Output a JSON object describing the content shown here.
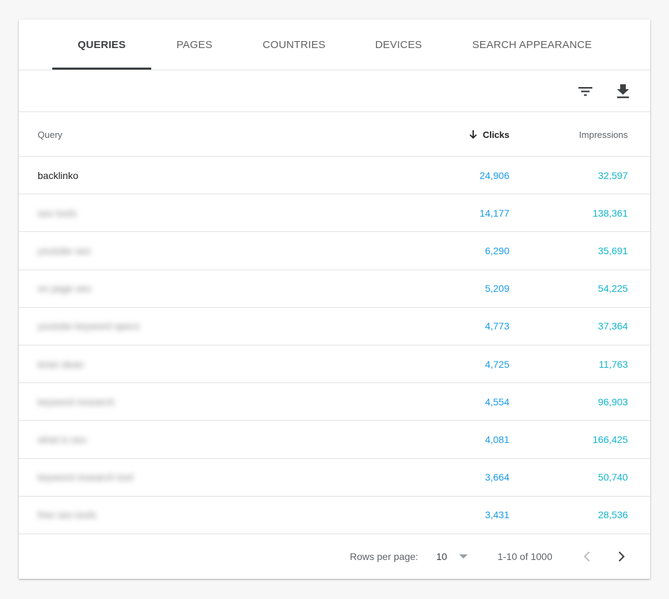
{
  "tabs": [
    {
      "label": "QUERIES",
      "active": true
    },
    {
      "label": "PAGES",
      "active": false
    },
    {
      "label": "COUNTRIES",
      "active": false
    },
    {
      "label": "DEVICES",
      "active": false
    },
    {
      "label": "SEARCH APPEARANCE",
      "active": false
    }
  ],
  "toolbar": {
    "filter_icon": "filter-icon",
    "download_icon": "download-icon"
  },
  "table": {
    "columns": {
      "query": "Query",
      "clicks": "Clicks",
      "impressions": "Impressions"
    },
    "sort_icon": "arrow-down-icon",
    "rows": [
      {
        "query": "backlinko",
        "blurred": false,
        "clicks": "24,906",
        "impressions": "32,597"
      },
      {
        "query": "seo tools",
        "blurred": true,
        "clicks": "14,177",
        "impressions": "138,361"
      },
      {
        "query": "youtube seo",
        "blurred": true,
        "clicks": "6,290",
        "impressions": "35,691"
      },
      {
        "query": "on page seo",
        "blurred": true,
        "clicks": "5,209",
        "impressions": "54,225"
      },
      {
        "query": "youtube keyword specs",
        "blurred": true,
        "clicks": "4,773",
        "impressions": "37,364"
      },
      {
        "query": "brian dean",
        "blurred": true,
        "clicks": "4,725",
        "impressions": "11,763"
      },
      {
        "query": "keyword research",
        "blurred": true,
        "clicks": "4,554",
        "impressions": "96,903"
      },
      {
        "query": "what is seo",
        "blurred": true,
        "clicks": "4,081",
        "impressions": "166,425"
      },
      {
        "query": "keyword research tool",
        "blurred": true,
        "clicks": "3,664",
        "impressions": "50,740"
      },
      {
        "query": "free seo tools",
        "blurred": true,
        "clicks": "3,431",
        "impressions": "28,536"
      }
    ]
  },
  "footer": {
    "rows_per_page_label": "Rows per page:",
    "rows_per_page_value": "10",
    "range": "1-10 of 1000",
    "prev_icon": "chevron-left-icon",
    "next_icon": "chevron-right-icon"
  },
  "colors": {
    "clicks": "#1a9be8",
    "impressions": "#12b5cb",
    "active_tab": "#3c4043"
  }
}
